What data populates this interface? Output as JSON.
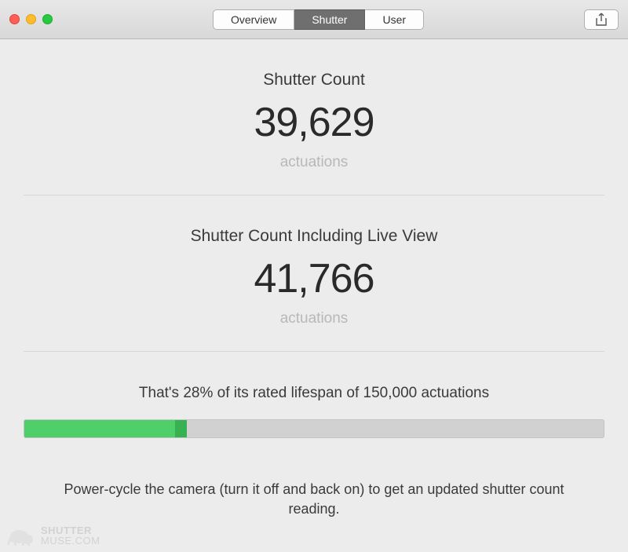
{
  "tabs": {
    "overview": "Overview",
    "shutter": "Shutter",
    "user": "User",
    "active": "shutter"
  },
  "shutter_count": {
    "title": "Shutter Count",
    "value": "39,629",
    "unit": "actuations"
  },
  "shutter_count_live": {
    "title": "Shutter Count Including Live View",
    "value": "41,766",
    "unit": "actuations"
  },
  "lifespan": {
    "text": "That's 28% of its rated lifespan of 150,000 actuations",
    "percent_a": 26,
    "percent_b": 28
  },
  "footer": "Power-cycle the camera (turn it off and back on) to get an updated shutter count reading.",
  "watermark": {
    "line1": "SHUTTER",
    "line2": "MUSE.COM"
  }
}
